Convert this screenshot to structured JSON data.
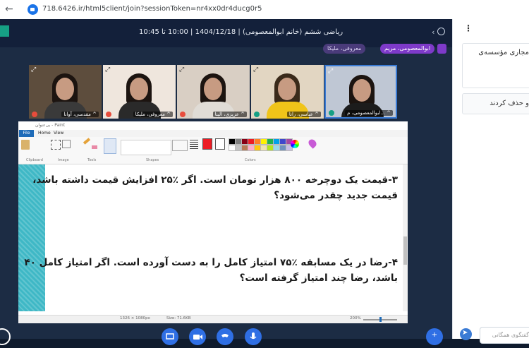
{
  "browser": {
    "url": "718.6426.ir/html5client/join?sessionToken=nr4xx0dr4ducg0r5",
    "back_glyph": "←"
  },
  "session": {
    "title": "ریاضی ششم (خانم ابوالمعصومی) | 1404/12/18 | 10:00 تا 10:45"
  },
  "speakers": [
    {
      "name": "ابوالمعصومی، مریم",
      "color": "#7e3ac9"
    },
    {
      "name": "معروفی، ملیکا",
      "color": "#4a3b7a"
    }
  ],
  "tiles": [
    {
      "name": "مقدسی، آوانا ^",
      "badge": "#e74c3c"
    },
    {
      "name": "معروفی، ملیکا ^",
      "badge": "#e74c3c"
    },
    {
      "name": "عزیزی، الینا ^",
      "badge": "#e74c3c"
    },
    {
      "name": "عباسی، رانا ^",
      "badge": "#16a085"
    },
    {
      "name": "ابوالمعصومی، م... ^",
      "badge": "#16a085"
    }
  ],
  "paint": {
    "window_title": "بی‌عنوان - Paint",
    "tabs": [
      "File",
      "Home",
      "View"
    ],
    "group_labels": [
      "Clipboard",
      "Image",
      "Tools",
      "Shapes",
      "Colors"
    ],
    "dimensions": "1326 × 1080px",
    "file_size": "Size: 71.6KB",
    "zoom": "200%",
    "palette": [
      "#000000",
      "#7f7f7f",
      "#880015",
      "#ed1c24",
      "#ff7f27",
      "#fff200",
      "#22b14c",
      "#00a2e8",
      "#3f48cc",
      "#a349a4",
      "#ffffff",
      "#c3c3c3",
      "#b97a57",
      "#ffaec9",
      "#ffc90e",
      "#efe4b0",
      "#b5e61d",
      "#99d9ea",
      "#7092be",
      "#c8bfe7"
    ]
  },
  "questions": {
    "q3_line1": "۳-قیمت یک دوچرخه ۸۰۰ هزار تومان است. اگر ٪۲۵ افزایش قیمت داشته باشد،",
    "q3_line2": "قیمت جدید چقدر می‌شود؟",
    "q4_line1": "۴-رضا در یک مسابقه ٪۷۵ امتیاز کامل را به دست آورده است. اگر امتیاز کامل ۴۰",
    "q4_line2": "باشد، رضا چند امتیاز گرفته است؟"
  },
  "controls": {
    "plus_glyph": "+"
  },
  "right_panel": {
    "menu_glyph": "⋮",
    "card1_text": "مجاری مؤسسه‌ی",
    "card2_text": "و حذف کردند",
    "chat_placeholder": "گفتگوی همگانی",
    "send_glyph": "➤"
  },
  "colors": {
    "accent": "#2f6fe4",
    "speaker_chip": "#7e3ac9",
    "app_bg": "#1c2c44"
  }
}
